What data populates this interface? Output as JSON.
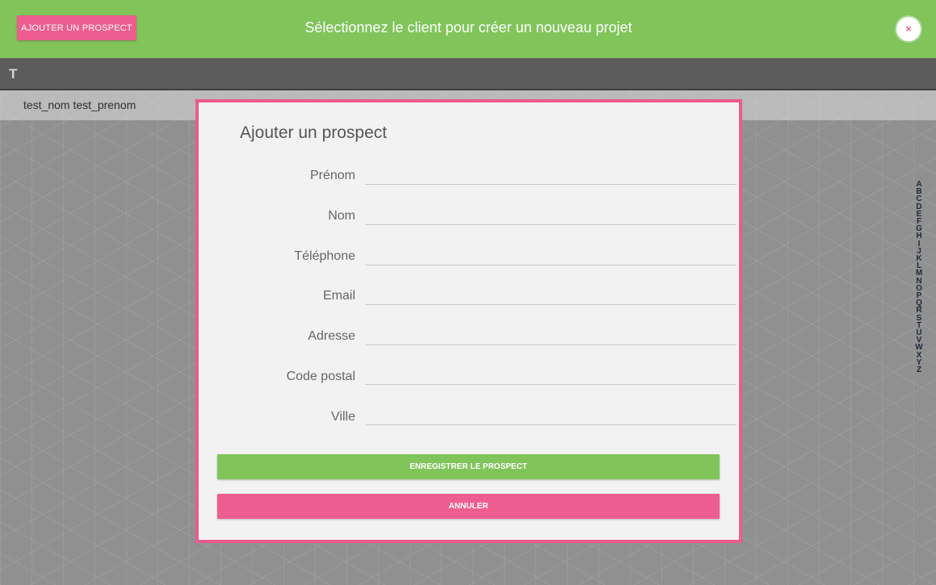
{
  "header": {
    "add_prospect_label": "AJOUTER UN PROSPECT",
    "title": "Sélectionnez le client pour créer un nouveau projet",
    "close_icon": "×"
  },
  "client_list": {
    "section_letter": "T",
    "clients": [
      "test_nom test_prenom"
    ]
  },
  "alphabet_index": [
    "A",
    "B",
    "C",
    "D",
    "E",
    "F",
    "G",
    "H",
    "I",
    "J",
    "K",
    "L",
    "M",
    "N",
    "O",
    "P",
    "Q",
    "R",
    "S",
    "T",
    "U",
    "V",
    "W",
    "X",
    "Y",
    "Z"
  ],
  "modal": {
    "title": "Ajouter un prospect",
    "fields": [
      {
        "label": "Prénom",
        "value": ""
      },
      {
        "label": "Nom",
        "value": ""
      },
      {
        "label": "Téléphone",
        "value": ""
      },
      {
        "label": "Email",
        "value": ""
      },
      {
        "label": "Adresse",
        "value": ""
      },
      {
        "label": "Code postal",
        "value": ""
      },
      {
        "label": "Ville",
        "value": ""
      }
    ],
    "save_label": "ENREGISTRER LE PROSPECT",
    "cancel_label": "ANNULER"
  },
  "colors": {
    "green": "#80c45a",
    "pink": "#ea5b8f",
    "dark_header": "#5c5c5c"
  }
}
